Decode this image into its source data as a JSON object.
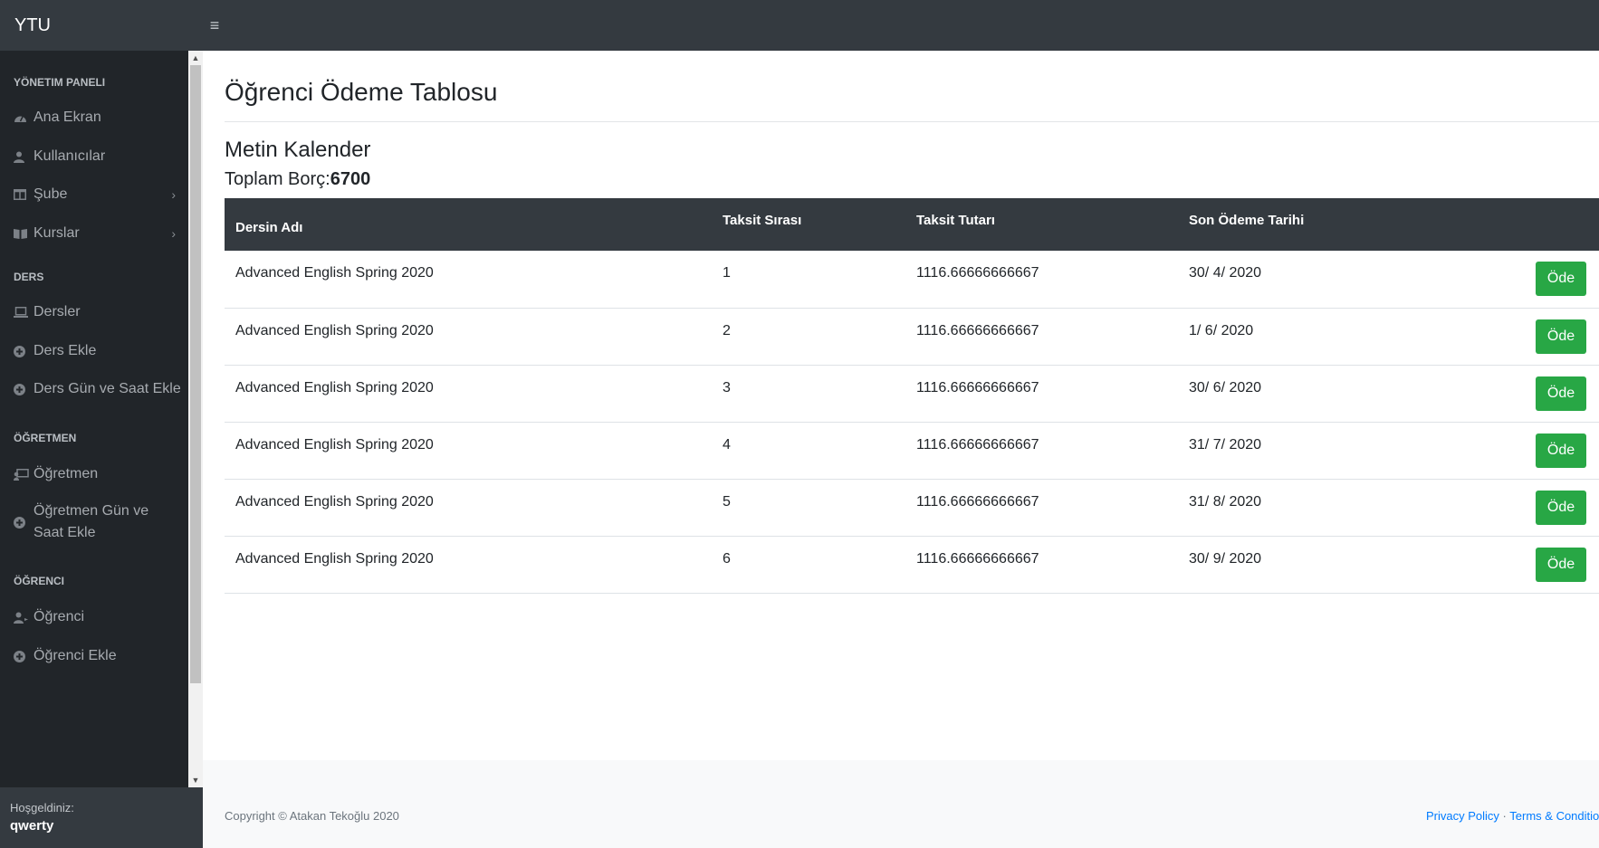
{
  "navbar": {
    "brand": "YTU",
    "menu_icon": "hamburger-icon"
  },
  "sidebar": {
    "sections": [
      {
        "heading": "YÖNETIM PANELI",
        "items": [
          {
            "label": "Ana Ekran",
            "icon": "dashboard-icon"
          },
          {
            "label": "Kullanıcılar",
            "icon": "user-icon"
          },
          {
            "label": "Şube",
            "icon": "columns-icon",
            "chevron": "›"
          },
          {
            "label": "Kurslar",
            "icon": "book-icon",
            "chevron": "›"
          }
        ]
      },
      {
        "heading": "DERS",
        "items": [
          {
            "label": "Dersler",
            "icon": "laptop-icon"
          },
          {
            "label": "Ders Ekle",
            "icon": "plus-circle-icon"
          },
          {
            "label": "Ders Gün ve Saat Ekle",
            "icon": "plus-circle-icon"
          }
        ]
      },
      {
        "heading": "ÖĞRETMEN",
        "items": [
          {
            "label": "Öğretmen",
            "icon": "chalkboard-teacher-icon"
          },
          {
            "label": "Öğretmen Gün ve Saat Ekle",
            "icon": "plus-circle-icon"
          }
        ]
      },
      {
        "heading": "ÖĞRENCI",
        "items": [
          {
            "label": "Öğrenci",
            "icon": "user-graduate-icon"
          },
          {
            "label": "Öğrenci Ekle",
            "icon": "plus-circle-icon"
          }
        ]
      }
    ],
    "footer": {
      "welcome": "Hoşgeldiniz:",
      "username": "qwerty"
    }
  },
  "main": {
    "title": "Öğrenci Ödeme Tablosu",
    "student_name": "Metin Kalender",
    "total_label": "Toplam Borç:",
    "total_value": "6700",
    "table": {
      "headers": [
        "Dersin Adı",
        "Taksit Sırası",
        "Taksit Tutarı",
        "Son Ödeme Tarihi"
      ],
      "rows": [
        {
          "course": "Advanced English Spring 2020",
          "installment": "1",
          "amount": "1116.66666666667",
          "due": "30/ 4/ 2020",
          "action": "Öde"
        },
        {
          "course": "Advanced English Spring 2020",
          "installment": "2",
          "amount": "1116.66666666667",
          "due": "1/ 6/ 2020",
          "action": "Öde"
        },
        {
          "course": "Advanced English Spring 2020",
          "installment": "3",
          "amount": "1116.66666666667",
          "due": "30/ 6/ 2020",
          "action": "Öde"
        },
        {
          "course": "Advanced English Spring 2020",
          "installment": "4",
          "amount": "1116.66666666667",
          "due": "31/ 7/ 2020",
          "action": "Öde"
        },
        {
          "course": "Advanced English Spring 2020",
          "installment": "5",
          "amount": "1116.66666666667",
          "due": "31/ 8/ 2020",
          "action": "Öde"
        },
        {
          "course": "Advanced English Spring 2020",
          "installment": "6",
          "amount": "1116.66666666667",
          "due": "30/ 9/ 2020",
          "action": "Öde"
        }
      ]
    }
  },
  "footer": {
    "copyright": "Copyright © Atakan Tekoğlu 2020",
    "privacy": "Privacy Policy",
    "separator": "·",
    "terms": "Terms & Conditions"
  },
  "colors": {
    "navbar": "#343a40",
    "sidebar": "#212529",
    "table_header": "#343a40",
    "pay_button": "#28a745",
    "link": "#007bff"
  }
}
